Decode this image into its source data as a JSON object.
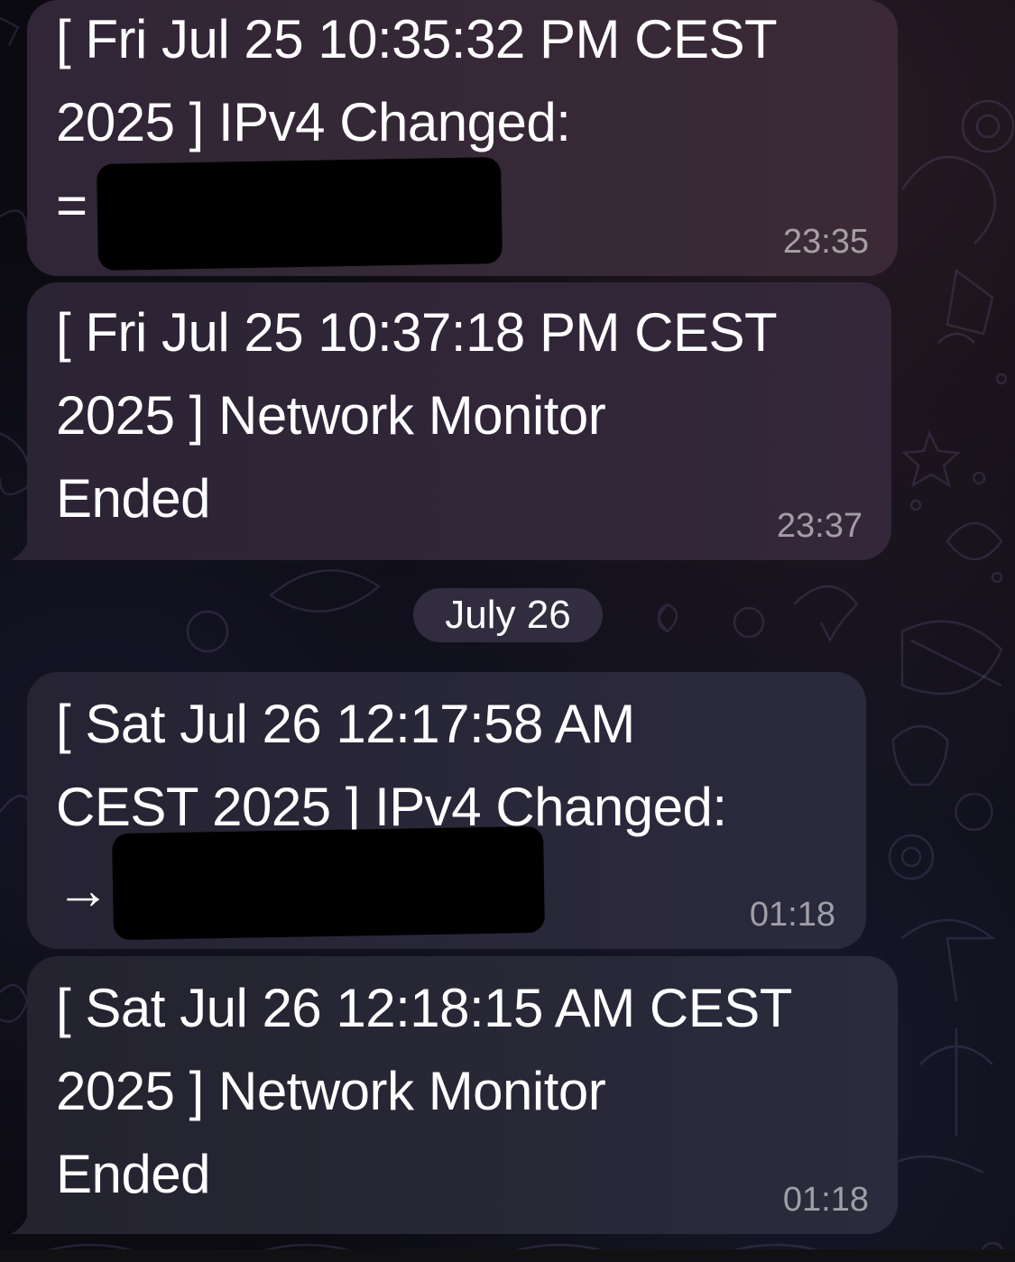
{
  "chat": {
    "date_separator": "July 26",
    "messages": [
      {
        "text": "[ Fri Jul 25 10:35:32 PM CEST\n2025 ] IPv4 Changed:\n=",
        "time": "23:35",
        "redacted": true
      },
      {
        "text": "[ Fri Jul 25 10:37:18 PM CEST\n2025 ] Network Monitor\nEnded",
        "time": "23:37",
        "redacted": false
      },
      {
        "text": "[ Sat Jul 26 12:17:58 AM\nCEST 2025 ] IPv4 Changed:\n→",
        "time": "01:18",
        "redacted": true
      },
      {
        "text": "[ Sat Jul 26 12:18:15 AM CEST\n2025 ] Network Monitor\nEnded",
        "time": "01:18",
        "redacted": false
      }
    ]
  },
  "colors": {
    "bubble_top": "#3a2a36",
    "bubble_bottom": "#262436",
    "text": "#ffffff",
    "time": "#9a98a6"
  }
}
